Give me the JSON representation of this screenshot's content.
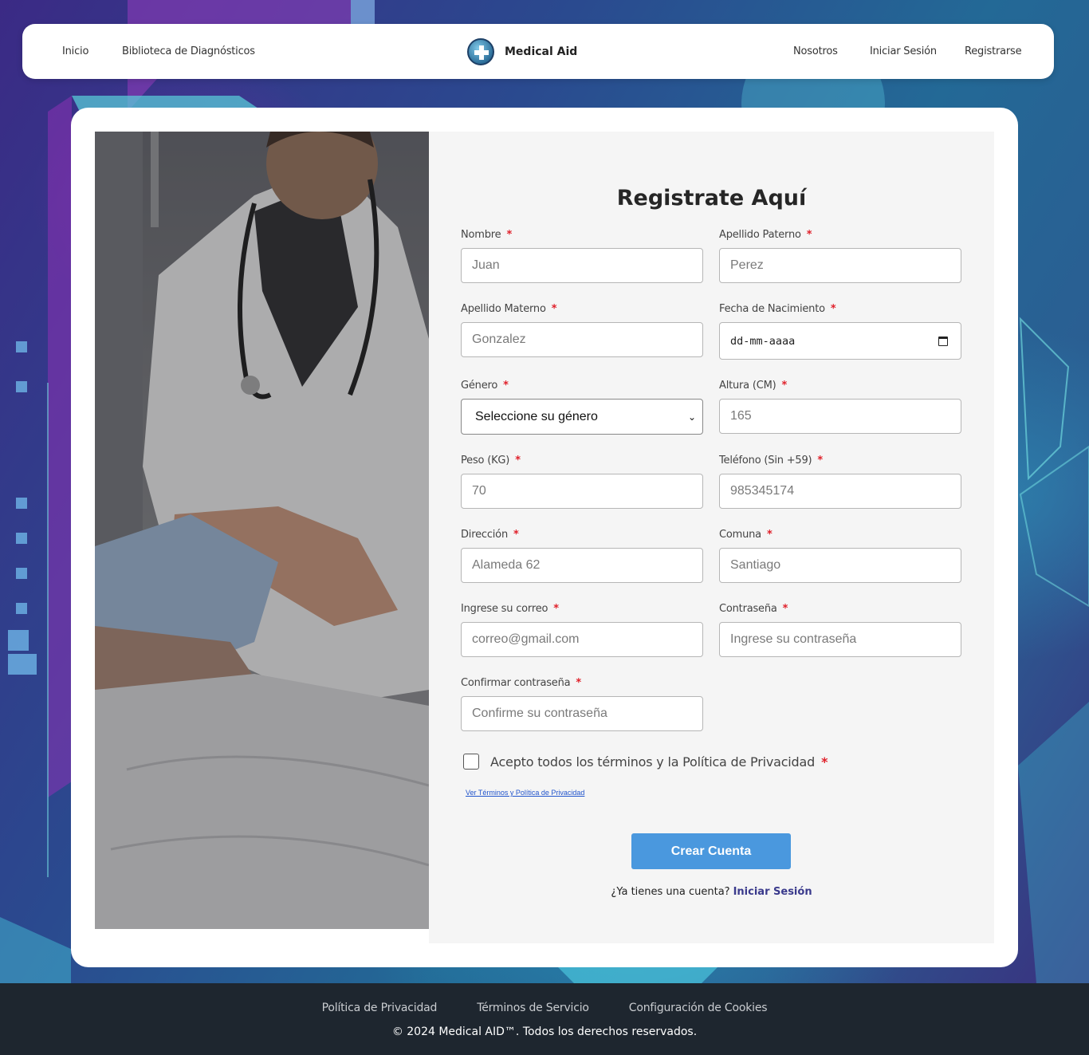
{
  "nav": {
    "left_links": [
      "Inicio",
      "Biblioteca de Diagnósticos"
    ],
    "brand": "Medical Aid",
    "right_links": [
      "Nosotros",
      "Iniciar Sesión",
      "Registrarse"
    ]
  },
  "form": {
    "title": "Registrate Aquí",
    "required_mark": "*",
    "fields": {
      "nombre": {
        "label": "Nombre",
        "placeholder": "Juan"
      },
      "apellido_paterno": {
        "label": "Apellido Paterno",
        "placeholder": "Perez"
      },
      "apellido_materno": {
        "label": "Apellido Materno",
        "placeholder": "Gonzalez"
      },
      "fecha_nacimiento": {
        "label": "Fecha de Nacimiento",
        "value": "dd-mm-aaaa"
      },
      "genero": {
        "label": "Género",
        "selected": "Seleccione su género"
      },
      "altura": {
        "label": "Altura (CM)",
        "placeholder": "165"
      },
      "peso": {
        "label": "Peso (KG)",
        "placeholder": "70"
      },
      "telefono": {
        "label": "Teléfono (Sin +59)",
        "placeholder": "985345174"
      },
      "direccion": {
        "label": "Dirección",
        "placeholder": "Alameda 62"
      },
      "comuna": {
        "label": "Comuna",
        "placeholder": "Santiago"
      },
      "correo": {
        "label": "Ingrese su correo",
        "placeholder": "correo@gmail.com"
      },
      "contrasena": {
        "label": "Contraseña",
        "placeholder": "Ingrese su contraseña"
      },
      "confirmar": {
        "label": "Confirmar contraseña",
        "placeholder": "Confirme su contraseña"
      }
    },
    "terms_label": "Acepto todos los términos y la Política de Privacidad",
    "terms_link": "Ver Términos y Política de Privacidad",
    "submit_label": "Crear Cuenta",
    "login_prompt": "¿Ya tienes una cuenta?",
    "login_link": "Iniciar Sesión"
  },
  "footer": {
    "links": [
      "Política de Privacidad",
      "Términos de Servicio",
      "Configuración de Cookies"
    ],
    "copyright": "© 2024 Medical AID™. Todos los derechos reservados."
  },
  "colors": {
    "accent": "#4a98de",
    "required": "#e0202a",
    "footer_bg": "#1e262f"
  }
}
